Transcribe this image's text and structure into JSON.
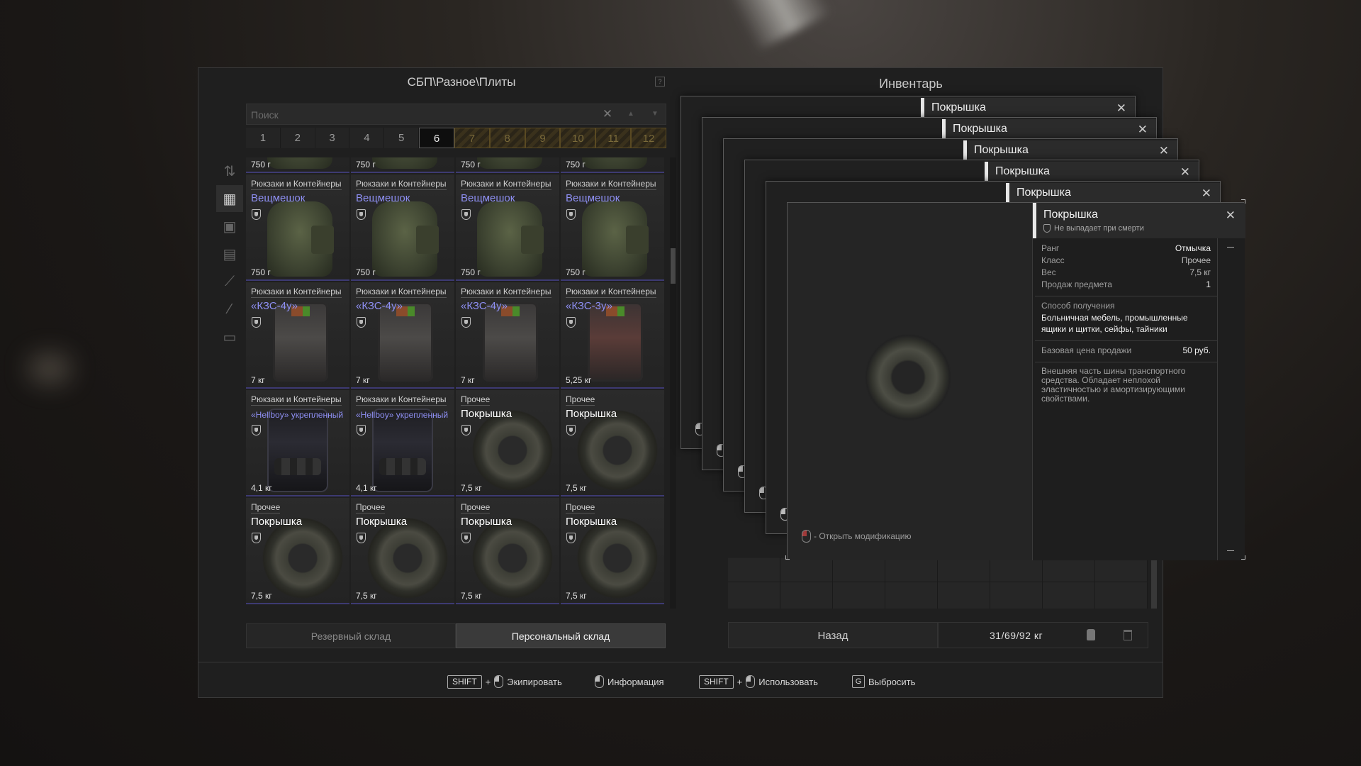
{
  "stash": {
    "breadcrumb": "СБП\\Разное\\Плиты",
    "help_label": "?",
    "search_placeholder": "Поиск",
    "search_clear": "✕",
    "pages": [
      "1",
      "2",
      "3",
      "4",
      "5",
      "6",
      "7",
      "8",
      "9",
      "10",
      "11",
      "12"
    ],
    "active_page": "6",
    "locked_pages": [
      "7",
      "8",
      "9",
      "10",
      "11",
      "12"
    ],
    "categories": [
      "sort-icon",
      "grid-icon",
      "vest-icon",
      "armor-icon",
      "rifle-icon",
      "knife-icon",
      "box-icon"
    ],
    "top_row_weights": [
      "750 г",
      "750 г",
      "750 г",
      "750 г"
    ],
    "rows": [
      [
        {
          "category": "Рюкзаки и Контейнеры",
          "name": "Вещмешок",
          "name_color": "#8e8ff3",
          "icon": "bag",
          "weight": "750 г"
        },
        {
          "category": "Рюкзаки и Контейнеры",
          "name": "Вещмешок",
          "name_color": "#8e8ff3",
          "icon": "bag",
          "weight": "750 г"
        },
        {
          "category": "Рюкзаки и Контейнеры",
          "name": "Вещмешок",
          "name_color": "#8e8ff3",
          "icon": "bag",
          "weight": "750 г"
        },
        {
          "category": "Рюкзаки и Контейнеры",
          "name": "Вещмешок",
          "name_color": "#8e8ff3",
          "icon": "bag",
          "weight": "750 г"
        }
      ],
      [
        {
          "category": "Рюкзаки и Контейнеры",
          "name": "«КЗС-4у»",
          "name_color": "#8e8ff3",
          "icon": "kzs",
          "weight": "7 кг"
        },
        {
          "category": "Рюкзаки и Контейнеры",
          "name": "«КЗС-4у»",
          "name_color": "#8e8ff3",
          "icon": "kzs",
          "weight": "7 кг"
        },
        {
          "category": "Рюкзаки и Контейнеры",
          "name": "«КЗС-4у»",
          "name_color": "#8e8ff3",
          "icon": "kzs",
          "weight": "7 кг"
        },
        {
          "category": "Рюкзаки и Контейнеры",
          "name": "«КЗС-3у»",
          "name_color": "#8e8ff3",
          "icon": "kzs-red",
          "weight": "5,25 кг"
        }
      ],
      [
        {
          "category": "Рюкзаки и Контейнеры",
          "name": "«Hellboy» укрепленный",
          "name_color": "#8e8ff3",
          "icon": "hellboy",
          "weight": "4,1 кг"
        },
        {
          "category": "Рюкзаки и Контейнеры",
          "name": "«Hellboy» укрепленный",
          "name_color": "#8e8ff3",
          "icon": "hellboy",
          "weight": "4,1 кг"
        },
        {
          "category": "Прочее",
          "name": "Покрышка",
          "name_color": "#ffffff",
          "icon": "tire",
          "weight": "7,5 кг"
        },
        {
          "category": "Прочее",
          "name": "Покрышка",
          "name_color": "#ffffff",
          "icon": "tire",
          "weight": "7,5 кг"
        }
      ],
      [
        {
          "category": "Прочее",
          "name": "Покрышка",
          "name_color": "#ffffff",
          "icon": "tire",
          "weight": "7,5 кг"
        },
        {
          "category": "Прочее",
          "name": "Покрышка",
          "name_color": "#ffffff",
          "icon": "tire",
          "weight": "7,5 кг"
        },
        {
          "category": "Прочее",
          "name": "Покрышка",
          "name_color": "#ffffff",
          "icon": "tire",
          "weight": "7,5 кг"
        },
        {
          "category": "Прочее",
          "name": "Покрышка",
          "name_color": "#ffffff",
          "icon": "tire",
          "weight": "7,5 кг"
        }
      ]
    ],
    "tab_reserve": "Резервный склад",
    "tab_personal": "Персональный склад"
  },
  "inventory": {
    "title": "Инвентарь",
    "back_label": "Назад",
    "weight": "31/69/92 кг"
  },
  "windows": [
    "Покрышка",
    "Покрышка",
    "Покрышка",
    "Покрышка",
    "Покрышка"
  ],
  "item_info": {
    "name": "Покрышка",
    "subtitle": "Не выпадает при смерти",
    "close": "✕",
    "props": [
      {
        "k": "Ранг",
        "v": "Отмычка"
      },
      {
        "k": "Класс",
        "v": "Прочее"
      },
      {
        "k": "Вес",
        "v": "7,5 кг"
      },
      {
        "k": "Продаж предмета",
        "v": "1"
      }
    ],
    "obtain_label": "Способ получения",
    "obtain_value": "Больничная мебель, промышленные ящики и щитки, сейфы, тайники",
    "price_label": "Базовая цена продажи",
    "price_value": "50 руб.",
    "description": "Внешняя часть шины транспортного средства. Обладает неплохой эластичностью и амортизирующими свойствами.",
    "open_mod": "- Открыть модификацию"
  },
  "hints": {
    "shift": "SHIFT",
    "plus": "+",
    "equip": "Экипировать",
    "info": "Информация",
    "use": "Использовать",
    "drop_key": "G",
    "drop": "Выбросить"
  },
  "colors": {
    "rare_name": "#8e8ff3",
    "panel": "#1f1f1f",
    "accent_white": "#e8e8e8"
  }
}
